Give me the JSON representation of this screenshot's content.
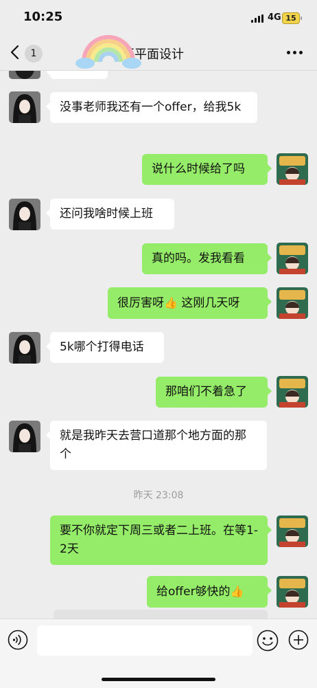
{
  "status": {
    "time": "10:25",
    "network": "4G",
    "battery": "15"
  },
  "header": {
    "back_count": "1",
    "title": "辰平面设计"
  },
  "messages": [
    {
      "side": "in",
      "text": "没事老师我还有一个offer，给我5k"
    },
    {
      "side": "out",
      "text": "说什么时候给了吗"
    },
    {
      "side": "in",
      "text": "还问我啥时候上班"
    },
    {
      "side": "out",
      "text": "真的吗。发我看看"
    },
    {
      "side": "out",
      "text_before": "很厉害呀",
      "emoji": "👍",
      "text_after": " 这刚几天呀"
    },
    {
      "side": "in",
      "text": "5k哪个打得电话"
    },
    {
      "side": "out",
      "text": "那咱们不着急了"
    },
    {
      "side": "in",
      "text": "就是我昨天去营口道那个地方面的那个"
    },
    {
      "side": "out",
      "text": "要不你就定下周三或者二上班。在等1-2天"
    },
    {
      "side": "out",
      "text_before": "给offer够快的",
      "emoji": "👍",
      "text_after": ""
    }
  ],
  "timestamp": "昨天 23:08",
  "icons": {
    "back": "back-chevron-icon",
    "more": "more-dots-icon",
    "voice": "voice-icon",
    "emoji": "emoji-icon",
    "plus": "plus-icon"
  },
  "colors": {
    "bubble_out": "#95ec69",
    "bubble_in": "#ffffff",
    "background": "#ededed"
  }
}
